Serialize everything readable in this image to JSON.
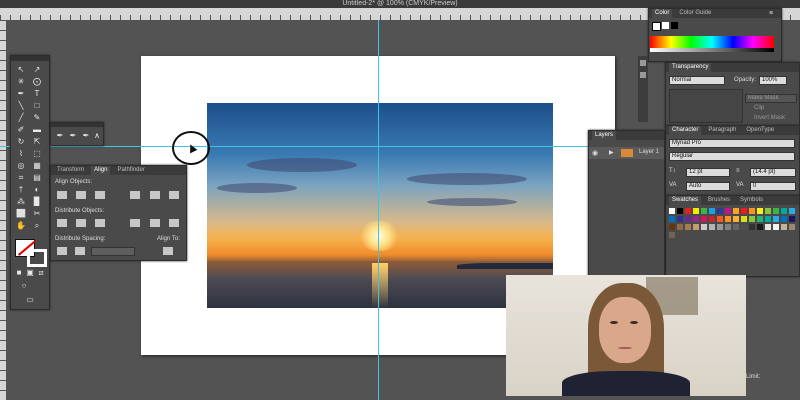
{
  "window": {
    "title": "Untitled-2* @ 100% (CMYK/Preview)"
  },
  "colors": {
    "guide": "#3ec5e0",
    "panel_bg": "#4a4a4a",
    "workspace": "#535353"
  },
  "align_panel": {
    "tabs": [
      "Transform",
      "Align",
      "Pathfinder"
    ],
    "active_tab": "Align",
    "align_objects_label": "Align Objects:",
    "distribute_objects_label": "Distribute Objects:",
    "distribute_spacing_label": "Distribute Spacing:",
    "align_to_label": "Align To:"
  },
  "color_panel": {
    "tabs": [
      "Color",
      "Color Guide"
    ]
  },
  "transparency_panel": {
    "tab": "Transparency",
    "blend_mode": "Normal",
    "opacity_label": "Opacity:",
    "opacity_value": "100%",
    "buttons": [
      "Make Mask",
      "Clip",
      "Invert Mask"
    ]
  },
  "character_panel": {
    "tabs": [
      "Character",
      "Paragraph",
      "OpenType"
    ],
    "font_family": "Myriad Pro",
    "font_style": "Regular",
    "font_size": "12 pt",
    "leading": "(14.4 pt)",
    "kerning": "Auto",
    "tracking": "0"
  },
  "swatches_panel": {
    "tabs": [
      "Swatches",
      "Brushes",
      "Symbols"
    ]
  },
  "layers_panel": {
    "tab": "Layers",
    "layer_name": "Layer 1"
  },
  "footer": {
    "limit_label": "Limit:"
  },
  "icons": [
    "selection-tool-icon",
    "direct-selection-tool-icon",
    "pen-tool-icon",
    "type-tool-icon",
    "line-tool-icon",
    "rectangle-tool-icon",
    "paintbrush-tool-icon",
    "pencil-tool-icon",
    "rotate-tool-icon",
    "scale-tool-icon",
    "eyedropper-tool-icon",
    "hand-tool-icon",
    "zoom-tool-icon",
    "eye-icon",
    "close-icon",
    "menu-icon"
  ]
}
